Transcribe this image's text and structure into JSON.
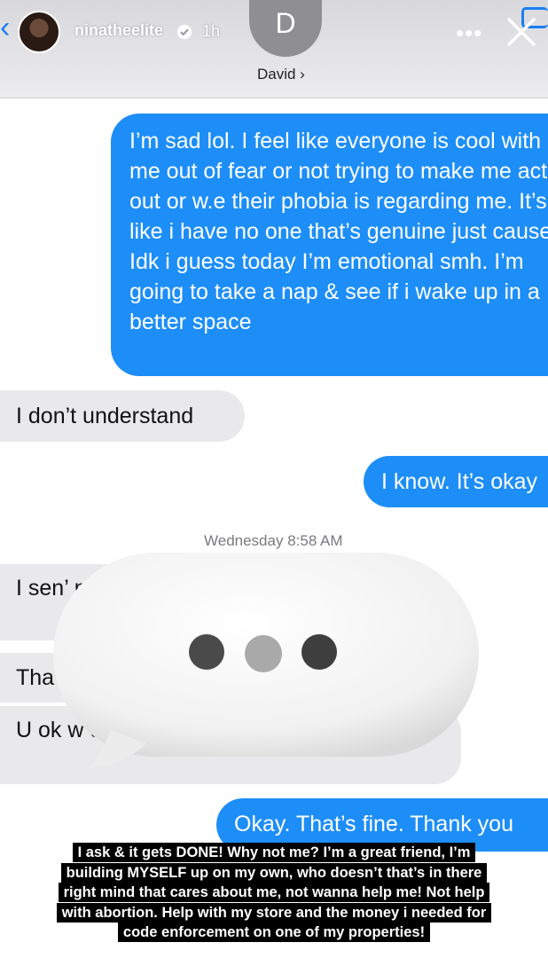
{
  "story": {
    "username": "ninatheelite",
    "time_ago": "1h",
    "more": "•••"
  },
  "conversation": {
    "contact_initial": "D",
    "contact_name": "David ›",
    "timestamp": "Wednesday 8:58 AM",
    "messages": [
      {
        "from": "me",
        "text": "I’m sad lol. I feel like everyone is cool with me out of fear or not trying to make me act out or w.e their phobia is regarding me. It’s like i have no one that’s genuine just cause. Idk i guess today I’m emotional smh. I’m going to take a nap & see if i wake up in a better space"
      },
      {
        "from": "them",
        "text": "I don’t understand"
      },
      {
        "from": "me",
        "text": "I know. It’s okay"
      },
      {
        "from": "them",
        "text": "I sen’ nex"
      },
      {
        "from": "them",
        "text": "Tha"
      },
      {
        "from": "them",
        "text": "U ok w u got on ?"
      },
      {
        "from": "me",
        "text": "Okay. That’s fine. Thank you"
      }
    ]
  },
  "caption": {
    "lines": [
      "I ask & it gets DONE! Why not me? I’m a great friend, I’m",
      "building MYSELF up on my own, who doesn’t that’s in there",
      "right mind that cares about me, not wanna help me! Not help",
      "with abortion. Help with my store and the money i needed for",
      "code enforcement on one of my properties!"
    ]
  },
  "colors": {
    "imessage_blue": "#1d8ef7",
    "received_grey": "#e9e9eb",
    "caption_bg": "#000000"
  },
  "icons": [
    "back-arrow-icon",
    "verified-badge-icon",
    "more-options-icon",
    "close-icon",
    "video-call-icon",
    "typing-indicator-icon"
  ]
}
